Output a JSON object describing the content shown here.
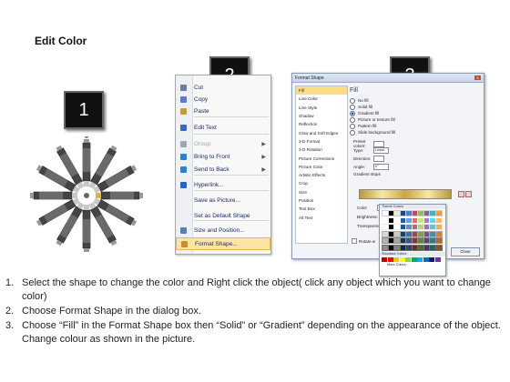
{
  "title": "Edit Color",
  "badges": [
    "1",
    "2",
    "3"
  ],
  "context_menu": {
    "items": [
      {
        "label": "Cut",
        "icon": "scissors-icon",
        "color": "#6a7d99"
      },
      {
        "label": "Copy",
        "icon": "copy-icon",
        "color": "#5b7cc4"
      },
      {
        "label": "Paste",
        "icon": "paste-icon",
        "color": "#c89a40"
      },
      {
        "label": "Edit Text",
        "icon": "edit-text-icon",
        "color": "#3a6db0"
      },
      {
        "label": "Group",
        "icon": "group-icon",
        "color": "#9aa7b8"
      },
      {
        "label": "Bring to Front",
        "icon": "bring-front-icon",
        "color": "#2f7fc9"
      },
      {
        "label": "Send to Back",
        "icon": "send-back-icon",
        "color": "#2f7fc9"
      },
      {
        "label": "Hyperlink...",
        "icon": "hyperlink-icon",
        "color": "#2a66b8"
      },
      {
        "label": "Save as Picture...",
        "icon": "",
        "color": ""
      },
      {
        "label": "Set as Default Shape",
        "icon": "",
        "color": ""
      },
      {
        "label": "Size and Position...",
        "icon": "size-position-icon",
        "color": "#5a7fb6"
      },
      {
        "label": "Format Shape...",
        "icon": "format-shape-icon",
        "color": "#d08a2a"
      }
    ]
  },
  "dialog": {
    "title": "Format Shape",
    "categories": [
      "Fill",
      "Line Color",
      "Line Style",
      "Shadow",
      "Reflection",
      "Glow and Soft Edges",
      "3-D Format",
      "3-D Rotation",
      "Picture Corrections",
      "Picture Color",
      "Artistic Effects",
      "Crop",
      "Size",
      "Position",
      "Text Box",
      "Alt Text"
    ],
    "pane_heading": "Fill",
    "fill_options": [
      "No fill",
      "Solid fill",
      "Gradient fill",
      "Picture or texture fill",
      "Pattern fill",
      "Slide background fill"
    ],
    "selected_fill": "Gradient fill",
    "fields": {
      "preset_colors": "Preset colors:",
      "type": "Type:",
      "type_value": "Linear",
      "direction": "Direction:",
      "angle": "Angle:",
      "angle_value": "0°",
      "gradient_stops": "Gradient stops",
      "color": "Color",
      "position": "Position:",
      "position_value": "22%",
      "brightness": "Brightness:",
      "transparency": "Transparency:",
      "rotate": "Rotate w"
    },
    "palette": {
      "theme_label": "Theme Colors",
      "standard_label": "Standard Colors",
      "more_colors": "More Colors..."
    },
    "close_label": "Close"
  },
  "instructions": [
    {
      "num": "1.",
      "text": "Select the shape to change the color and Right click the object( click any object which you want to change color)"
    },
    {
      "num": "2.",
      "text": "Choose Format Shape in the dialog box."
    },
    {
      "num": "3.",
      "text": "Choose “Fill” in the Format Shape box then “Solid” or “Gradient” depending on the appearance of the object. Change colour as shown in the picture."
    }
  ]
}
